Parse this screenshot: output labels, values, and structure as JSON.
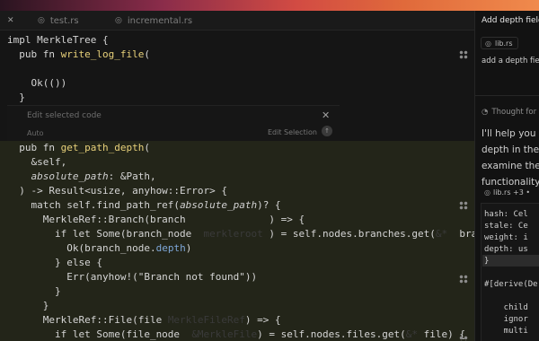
{
  "tabs": [
    {
      "label": "test.rs",
      "icon": "rust-file-icon"
    },
    {
      "label": "incremental.rs",
      "icon": "rust-file-icon"
    }
  ],
  "prompt": {
    "placeholder": "Edit selected code",
    "mode": "Auto",
    "action": "Edit Selection",
    "close_glyph": "✕",
    "send_glyph": "↑"
  },
  "chat": {
    "title": "Add depth field to",
    "file_chip": "lib.rs",
    "user_message": "add a depth field",
    "thought_label": "Thought for",
    "response_lines": [
      "I'll help you ac",
      "depth in the n",
      "examine the c",
      "functionality."
    ],
    "diff_file": "lib.rs +3 •",
    "diff_lines": [
      "hash: Cel",
      "stale: Ce",
      "weight: i",
      "depth: us",
      "}",
      "",
      "#[derive(De",
      "",
      "    child",
      "    ignor",
      "    multi"
    ]
  },
  "colors": {
    "accent_gradient": [
      "#8a2c4a",
      "#d24b43",
      "#f08a4c"
    ],
    "selection": "#232519",
    "function": "#e8d17a",
    "field": "#7ea7d8"
  }
}
